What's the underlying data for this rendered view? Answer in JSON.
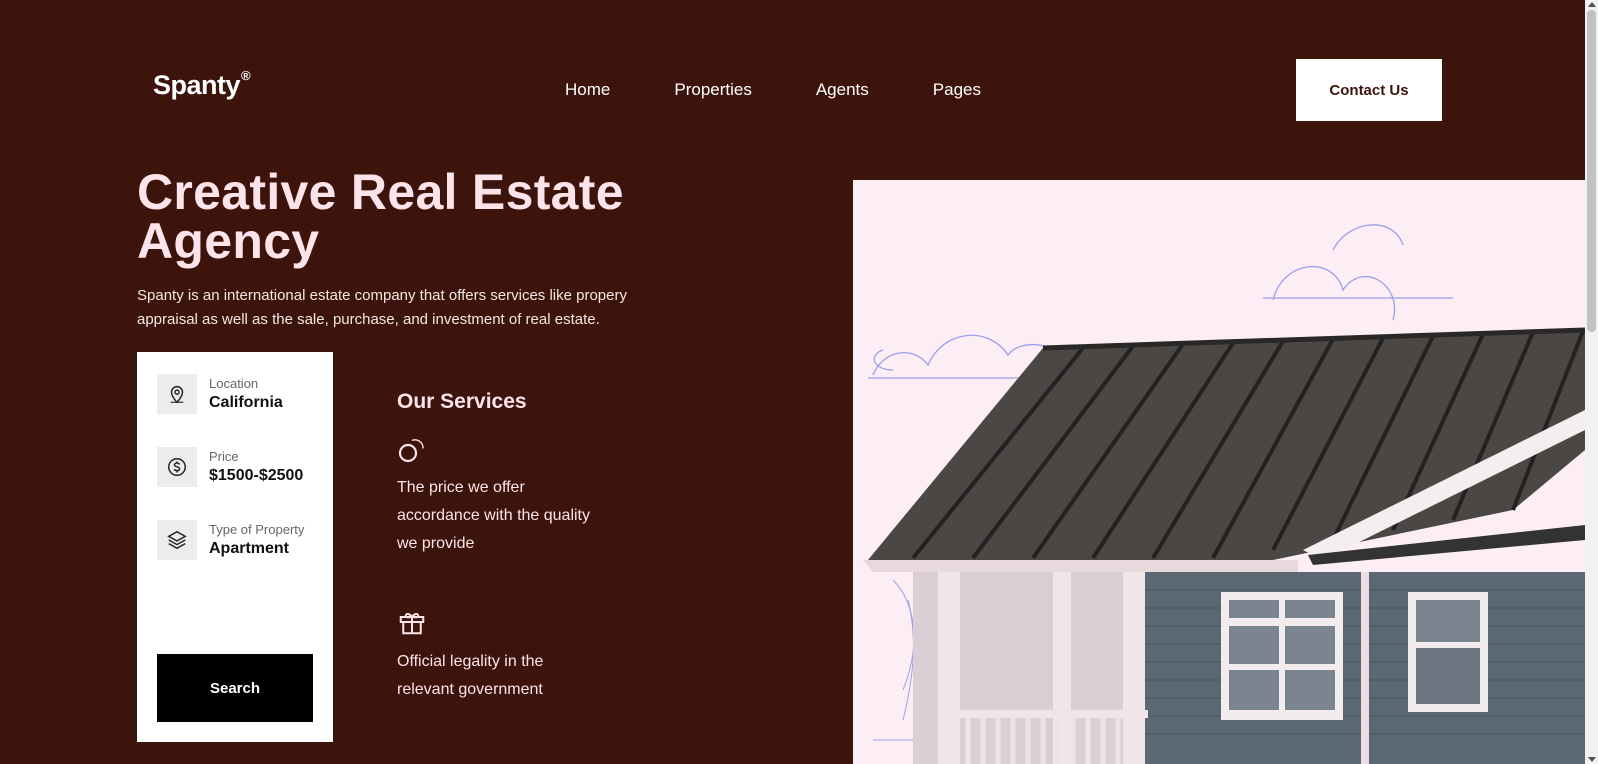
{
  "header": {
    "logo": "Spanty",
    "logo_mark": "®",
    "nav": [
      {
        "label": "Home"
      },
      {
        "label": "Properties"
      },
      {
        "label": "Agents"
      },
      {
        "label": "Pages"
      }
    ],
    "contact_label": "Contact Us"
  },
  "hero": {
    "title": "Creative Real Estate Agency",
    "description": "Spanty is an international estate company that offers services like propery appraisal as well as the sale, purchase, and investment of real estate."
  },
  "search_card": {
    "fields": [
      {
        "label": "Location",
        "value": "California",
        "icon": "location-pin-icon"
      },
      {
        "label": "Price",
        "value": "$1500-$2500",
        "icon": "dollar-coin-icon"
      },
      {
        "label": "Type of Property",
        "value": "Apartment",
        "icon": "layers-icon"
      }
    ],
    "search_label": "Search"
  },
  "services": {
    "title": "Our Services",
    "items": [
      {
        "text": "The price we offer accordance with the quality we provide",
        "icon": "loading-circle-icon"
      },
      {
        "text": "Official legality in the relevant government",
        "icon": "gift-icon"
      }
    ]
  },
  "colors": {
    "background": "#3d140c",
    "accent_text": "#fde3ea",
    "card": "#ffffff",
    "button": "#000000"
  }
}
